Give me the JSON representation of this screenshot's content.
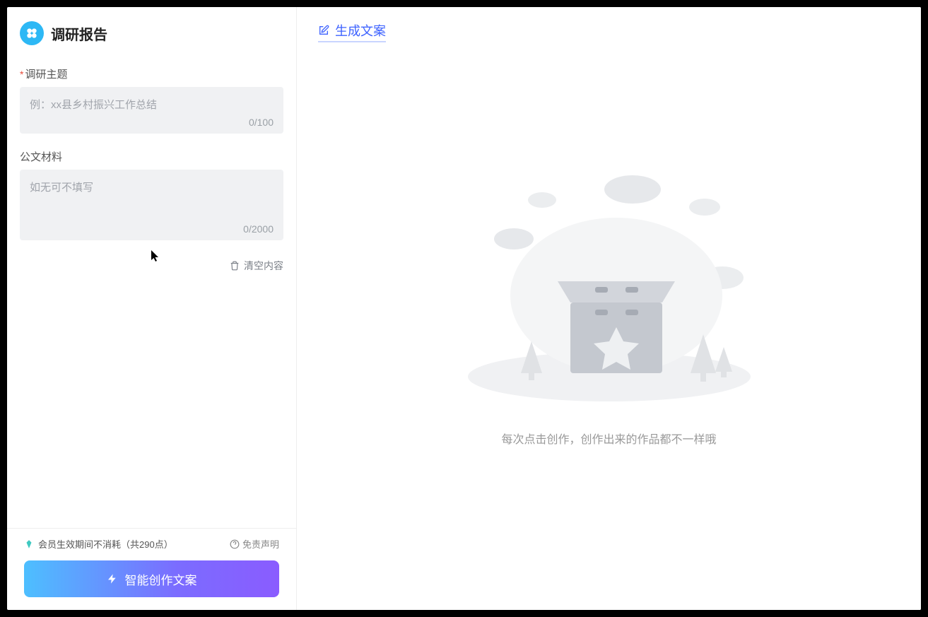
{
  "header": {
    "title": "调研报告"
  },
  "form": {
    "topic": {
      "label": "调研主题",
      "placeholder": "例：xx县乡村振兴工作总结",
      "counter": "0/100"
    },
    "material": {
      "label": "公文材料",
      "placeholder": "如无可不填写",
      "counter": "0/2000"
    },
    "clear_label": "清空内容"
  },
  "footer": {
    "credits_text": "会员生效期间不消耗（共290点）",
    "disclaimer_label": "免责声明",
    "generate_label": "智能创作文案"
  },
  "right": {
    "tab_label": "生成文案",
    "empty_text": "每次点击创作，创作出来的作品都不一样哦"
  }
}
